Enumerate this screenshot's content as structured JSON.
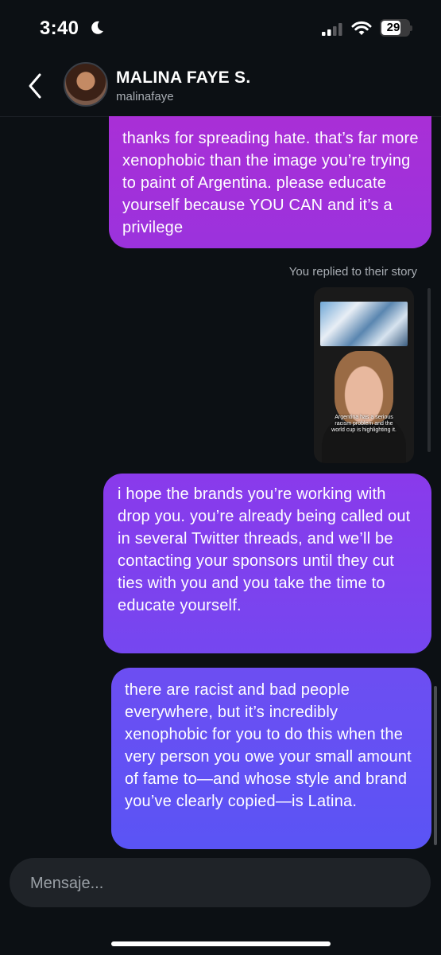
{
  "status": {
    "time": "3:40",
    "battery": "29"
  },
  "header": {
    "name": "MALINA FAYE S.",
    "handle": "malinafaye"
  },
  "messages": [
    {
      "text": "thanks for spreading hate. that’s far more xenophobic than the image you’re trying to paint of Argentina. please educate yourself because YOU CAN and it’s a privilege"
    },
    {
      "text": "i hope the brands you’re working with drop you. you’re already being called out in several Twitter threads, and we’ll be contacting your sponsors until they cut ties with you and you take the time to educate yourself."
    },
    {
      "text": "there are racist and bad people everywhere, but it’s incredibly xenophobic for you to do this when the very person you owe your small amount of fame to—and whose style and brand you’ve clearly copied—is Latina."
    }
  ],
  "story_reply": {
    "note": "You replied to their story",
    "caption": "Argentina has a serious racism problem and the world cup is highlighting it."
  },
  "composer": {
    "placeholder": "Mensaje..."
  },
  "colors": {
    "background": "#0c1014",
    "bubble_1": "#a92fd6",
    "bubble_2": "#8a3aeb",
    "bubble_3": "#5a54f5"
  }
}
